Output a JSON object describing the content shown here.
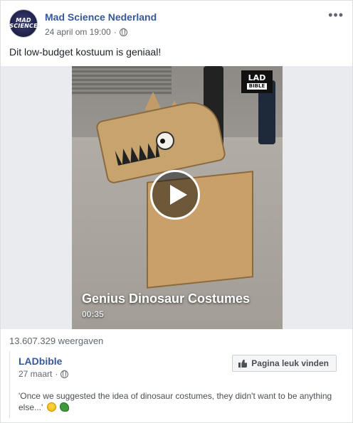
{
  "post": {
    "page_name": "Mad Science Nederland",
    "avatar_text_line1": "MAD",
    "avatar_text_line2": "SCIENCE",
    "timestamp": "24 april om 19:00",
    "more_label": "•••",
    "caption": "Dit low-budget kostuum is geniaal!"
  },
  "video": {
    "title": "Genius Dinosaur Costumes",
    "duration": "00:35",
    "brand_logo_top": "LAD",
    "brand_logo_bottom": "BIBLE",
    "play_state": "paused"
  },
  "stats": {
    "views": "13.607.329 weergaven"
  },
  "shared_source": {
    "name": "LADbible",
    "date": "27 maart",
    "like_page_label": "Pagina leuk vinden",
    "text": "'Once we suggested the idea of dinosaur costumes, they didn't want to be anything else...'",
    "emojis": [
      "laughing-emoji",
      "dinosaur-emoji"
    ]
  },
  "colors": {
    "link_blue": "#365899",
    "meta_gray": "#616770",
    "border": "#dddfe2",
    "video_letterbox": "#e9ebee"
  }
}
